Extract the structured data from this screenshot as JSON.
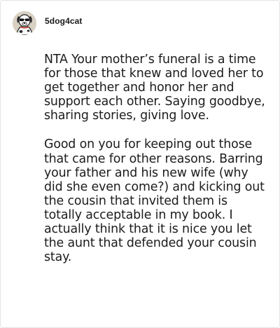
{
  "comment": {
    "author": {
      "username": "5dog4cat",
      "avatar_icon": "dog-with-sunglasses-avatar"
    },
    "paragraphs": [
      "NTA Your mother’s funeral is a time for those that knew and loved her to get together and honor her and support each other. Saying goodbye, sharing stories, giving love.",
      "Good on you for keeping out those that came for other reasons. Barring your father and his new wife (why did she even come?) and kicking out the cousin that invited them is totally acceptable in my book. I actually think that it is nice you let the aunt that defended your cousin stay."
    ]
  }
}
